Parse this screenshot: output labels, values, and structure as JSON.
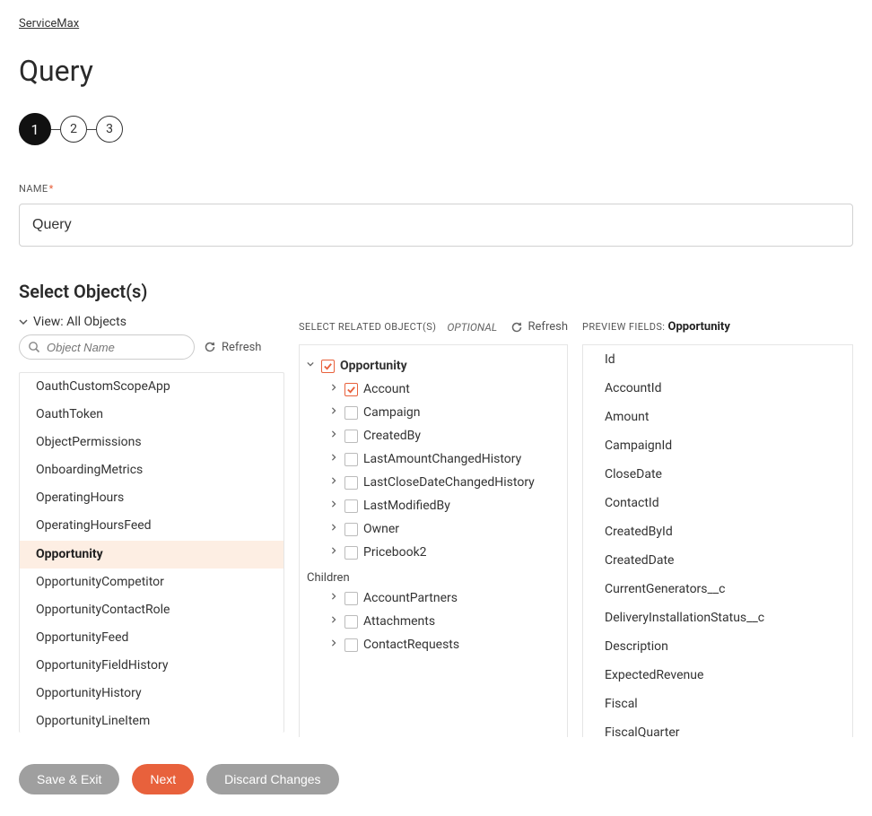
{
  "breadcrumb": {
    "link": "ServiceMax"
  },
  "page_title": "Query",
  "stepper": {
    "steps": [
      "1",
      "2",
      "3"
    ],
    "active_index": 0
  },
  "name_field": {
    "label": "NAME",
    "required_marker": "*",
    "value": "Query"
  },
  "select_objects_heading": "Select Object(s)",
  "left": {
    "view_label": "View: All Objects",
    "search_placeholder": "Object Name",
    "refresh_label": "Refresh",
    "items": [
      "OauthCustomScopeApp",
      "OauthToken",
      "ObjectPermissions",
      "OnboardingMetrics",
      "OperatingHours",
      "OperatingHoursFeed",
      "Opportunity",
      "OpportunityCompetitor",
      "OpportunityContactRole",
      "OpportunityFeed",
      "OpportunityFieldHistory",
      "OpportunityHistory",
      "OpportunityLineItem"
    ],
    "selected_item": "Opportunity"
  },
  "middle": {
    "label": "SELECT RELATED OBJECT(S)",
    "optional_label": "OPTIONAL",
    "refresh_label": "Refresh",
    "root": {
      "label": "Opportunity",
      "checked": true
    },
    "related": [
      {
        "label": "Account",
        "checked": true
      },
      {
        "label": "Campaign",
        "checked": false
      },
      {
        "label": "CreatedBy",
        "checked": false
      },
      {
        "label": "LastAmountChangedHistory",
        "checked": false
      },
      {
        "label": "LastCloseDateChangedHistory",
        "checked": false
      },
      {
        "label": "LastModifiedBy",
        "checked": false
      },
      {
        "label": "Owner",
        "checked": false
      },
      {
        "label": "Pricebook2",
        "checked": false
      }
    ],
    "children_label": "Children",
    "children": [
      {
        "label": "AccountPartners",
        "checked": false
      },
      {
        "label": "Attachments",
        "checked": false
      },
      {
        "label": "ContactRequests",
        "checked": false
      }
    ]
  },
  "right": {
    "label": "PREVIEW FIELDS:",
    "object": "Opportunity",
    "fields": [
      "Id",
      "AccountId",
      "Amount",
      "CampaignId",
      "CloseDate",
      "ContactId",
      "CreatedById",
      "CreatedDate",
      "CurrentGenerators__c",
      "DeliveryInstallationStatus__c",
      "Description",
      "ExpectedRevenue",
      "Fiscal",
      "FiscalQuarter"
    ]
  },
  "footer": {
    "save_exit": "Save & Exit",
    "next": "Next",
    "discard": "Discard Changes"
  },
  "icons": {
    "chevron_down": "⌄",
    "chevron_right": "›"
  }
}
